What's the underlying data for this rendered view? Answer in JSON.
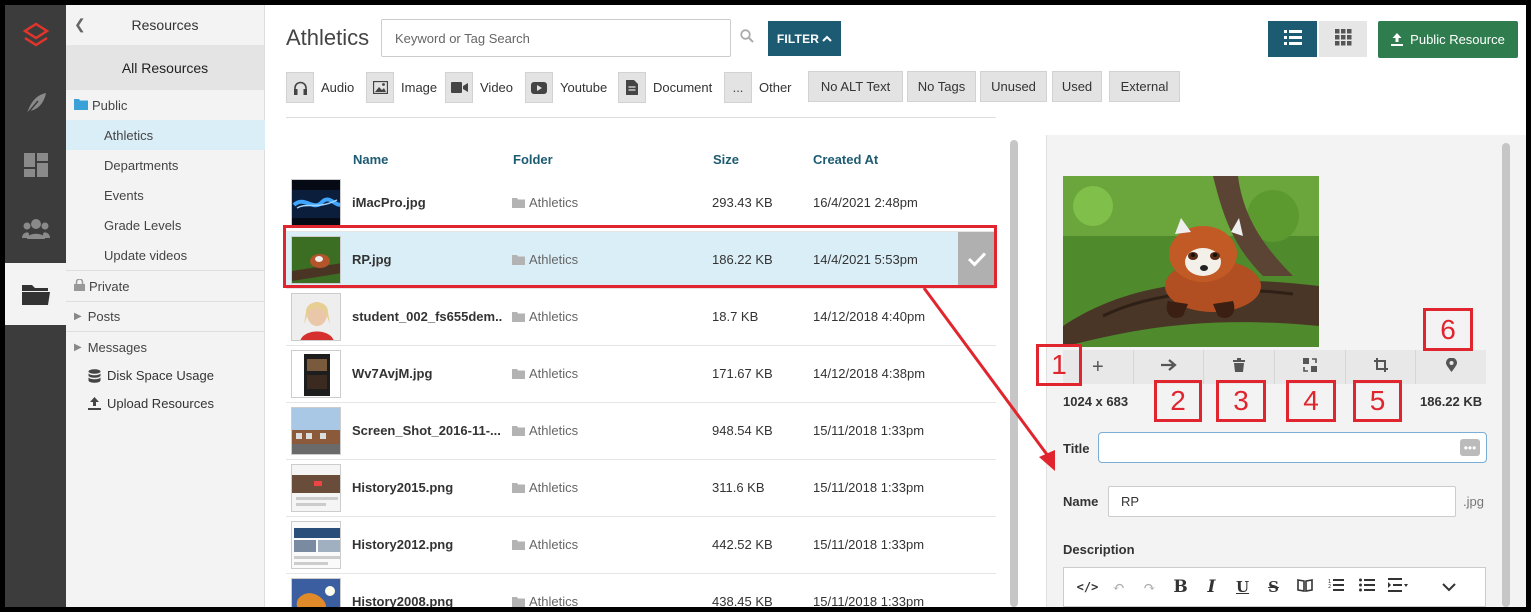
{
  "sidebar": {
    "header": "Resources",
    "all_resources": "All Resources",
    "public_label": "Public",
    "public_children": [
      "Athletics",
      "Departments",
      "Events",
      "Grade Levels",
      "Update videos"
    ],
    "private_label": "Private",
    "posts_label": "Posts",
    "messages_label": "Messages",
    "disk_space": "Disk Space Usage",
    "upload": "Upload Resources"
  },
  "header": {
    "title": "Athletics",
    "search_placeholder": "Keyword or Tag Search",
    "filter_label": "FILTER",
    "public_resource_label": "Public Resource"
  },
  "type_filters": [
    "Audio",
    "Image",
    "Video",
    "Youtube",
    "Document",
    "Other"
  ],
  "tag_filters": [
    "No ALT Text",
    "No Tags",
    "Unused",
    "Used",
    "External"
  ],
  "table": {
    "columns": [
      "Name",
      "Folder",
      "Size",
      "Created At"
    ],
    "rows": [
      {
        "name": "iMacPro.jpg",
        "folder": "Athletics",
        "size": "293.43 KB",
        "created": "16/4/2021 2:48pm"
      },
      {
        "name": "RP.jpg",
        "folder": "Athletics",
        "size": "186.22 KB",
        "created": "14/4/2021 5:53pm"
      },
      {
        "name": "student_002_fs655dem...",
        "folder": "Athletics",
        "size": "18.7 KB",
        "created": "14/12/2018 4:40pm"
      },
      {
        "name": "Wv7AvjM.jpg",
        "folder": "Athletics",
        "size": "171.67 KB",
        "created": "14/12/2018 4:38pm"
      },
      {
        "name": "Screen_Shot_2016-11-...",
        "folder": "Athletics",
        "size": "948.54 KB",
        "created": "15/11/2018 1:33pm"
      },
      {
        "name": "History2015.png",
        "folder": "Athletics",
        "size": "311.6 KB",
        "created": "15/11/2018 1:33pm"
      },
      {
        "name": "History2012.png",
        "folder": "Athletics",
        "size": "442.52 KB",
        "created": "15/11/2018 1:33pm"
      },
      {
        "name": "History2008.png",
        "folder": "Athletics",
        "size": "438.45 KB",
        "created": "15/11/2018 1:33pm"
      }
    ],
    "selected_index": 1
  },
  "detail": {
    "dimensions": "1024 x 683",
    "file_size": "186.22 KB",
    "title_label": "Title",
    "title_value": "",
    "name_label": "Name",
    "name_value": "RP",
    "extension": ".jpg",
    "description_label": "Description",
    "toolbar_icons": [
      "plus-icon",
      "arrow-right-icon",
      "trash-icon",
      "replace-icon",
      "crop-icon",
      "map-pin-icon"
    ]
  },
  "annotations": [
    "1",
    "2",
    "3",
    "4",
    "5",
    "6"
  ],
  "colors": {
    "rail": "#3c3c3c",
    "accent": "#1d5b72",
    "primary_green": "#2f7d4f",
    "selected_row": "#daeef7",
    "annotation_red": "#e0252e"
  }
}
